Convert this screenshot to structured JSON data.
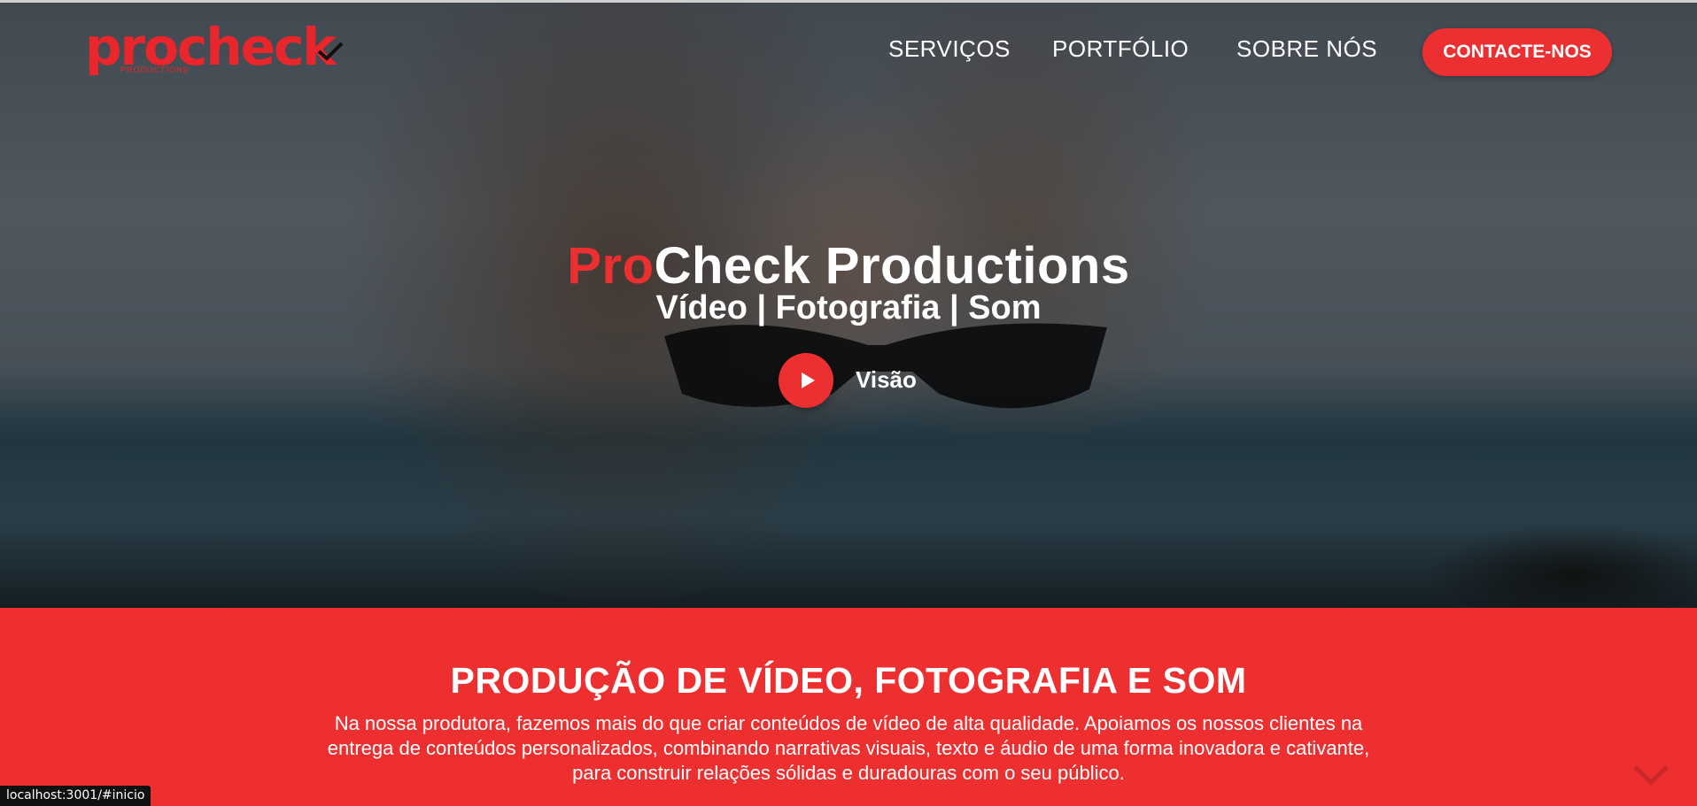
{
  "header": {
    "logo_text": "procheck",
    "logo_sub": "PRODUCTIONS",
    "nav": {
      "servicos": "SERVIÇOS",
      "portfolio": "PORTFÓLIO",
      "sobre": "SOBRE NÓS"
    },
    "cta_label": "CONTACTE-NOS"
  },
  "hero": {
    "title_accent": "Pro",
    "title_rest": "Check Productions",
    "subtitle": "Vídeo | Fotografia | Som",
    "play_label": "Visão"
  },
  "band": {
    "title": "PRODUÇÃO DE VÍDEO, FOTOGRAFIA E SOM",
    "text": "Na nossa produtora, fazemos mais do que criar conteúdos de vídeo de alta qualidade. Apoiamos os nossos clientes na entrega de conteúdos personalizados, combinando narrativas visuais, texto e áudio de uma forma inovadora e cativante, para construir relações sólidas e duradouras com o seu público."
  },
  "status_bar": {
    "url": "localhost:3001/#inicio"
  },
  "icons": {
    "play": "play-icon",
    "logo_check": "checkmark-icon",
    "scroll": "chevron-down-icon"
  },
  "colors": {
    "accent": "#ed2f30",
    "text_light": "#ffffff"
  }
}
